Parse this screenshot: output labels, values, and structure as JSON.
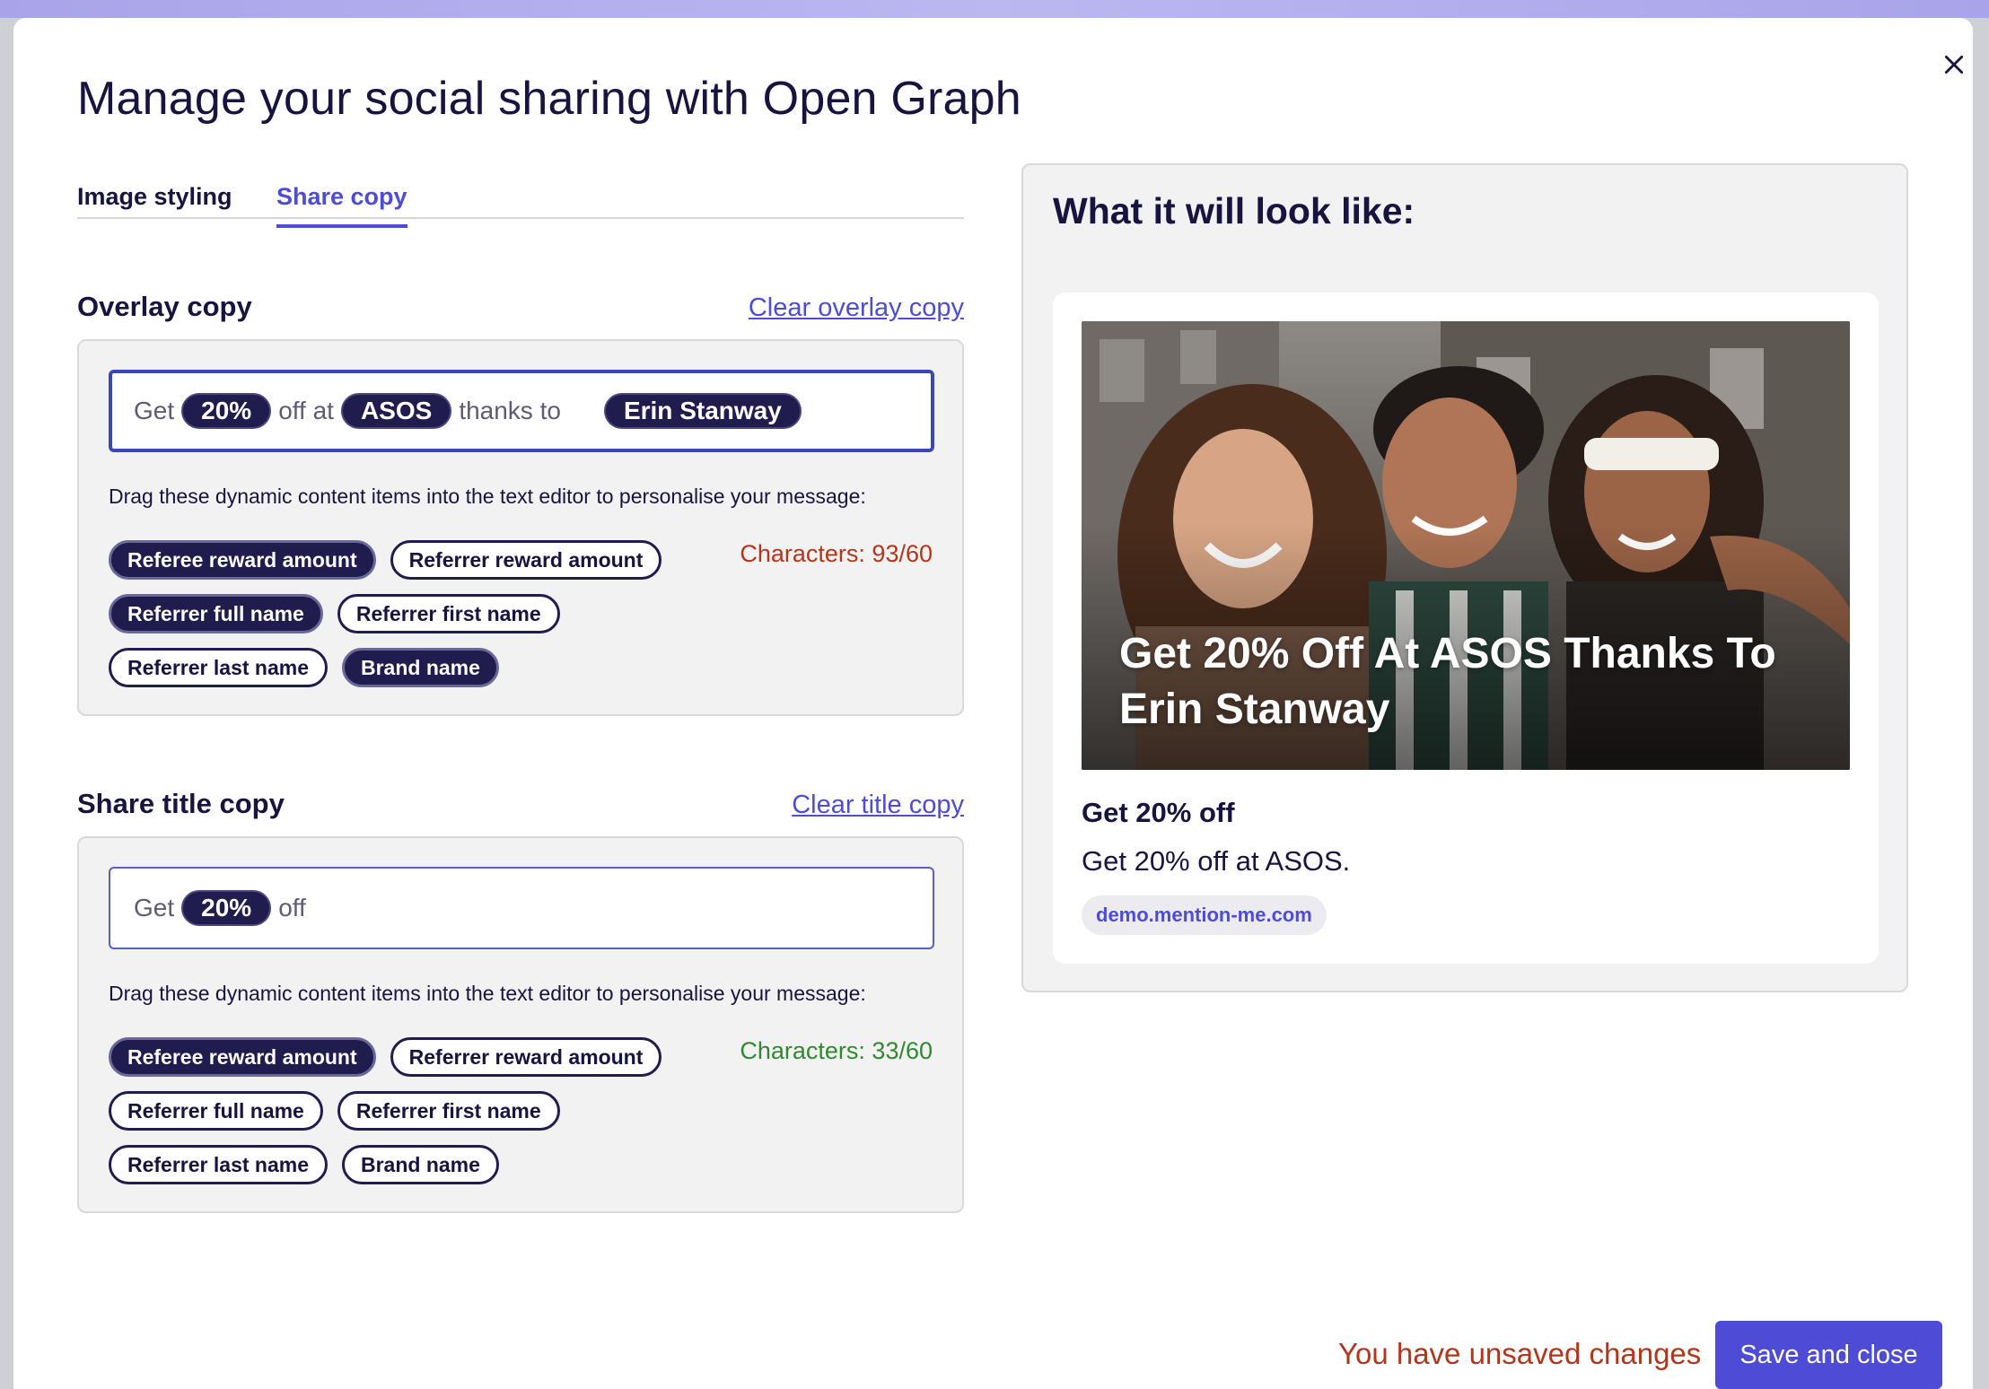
{
  "modal": {
    "title": "Manage your social sharing with Open Graph"
  },
  "tabs": [
    {
      "label": "Image styling",
      "active": false
    },
    {
      "label": "Share copy",
      "active": true
    }
  ],
  "overlay": {
    "heading": "Overlay copy",
    "clear_label": "Clear overlay copy",
    "editor": {
      "w1": "Get",
      "t1": "20%",
      "w2": "off at",
      "t2": "ASOS",
      "w3": "thanks to",
      "t3": "Erin Stanway"
    },
    "hint": "Drag these dynamic content items into the text editor to personalise your message:",
    "chips": {
      "referee_reward": "Referee reward amount",
      "referrer_reward": "Referrer reward amount",
      "referrer_full": "Referrer full name",
      "referrer_first": "Referrer first name",
      "referrer_last": "Referrer last name",
      "brand": "Brand name"
    },
    "char_count": "Characters: 93/60",
    "over_limit_color": "#b3361a"
  },
  "title_copy": {
    "heading": "Share title copy",
    "clear_label": "Clear title copy",
    "editor": {
      "w1": "Get",
      "t1": "20%",
      "w2": "off"
    },
    "hint": "Drag these dynamic content items into the text editor to personalise your message:",
    "chips": {
      "referee_reward": "Referee reward amount",
      "referrer_reward": "Referrer reward amount",
      "referrer_full": "Referrer full name",
      "referrer_first": "Referrer first name",
      "referrer_last": "Referrer last name",
      "brand": "Brand name"
    },
    "char_count": "Characters: 33/60",
    "ok_color": "#2f8a2f"
  },
  "preview": {
    "heading": "What it will look like:",
    "overlay_text": "Get 20% Off At ASOS Thanks To Erin Stanway",
    "og_title": "Get 20% off",
    "og_description": "Get 20% off at ASOS.",
    "og_domain": "demo.mention-me.com"
  },
  "footer": {
    "unsaved": "You have unsaved changes",
    "save_label": "Save and close"
  },
  "colors": {
    "accent": "#4e4cd6",
    "navy": "#17143f",
    "token_bg": "#201c4e",
    "warning": "#b3361a"
  },
  "icons": {
    "close": "close-icon"
  }
}
